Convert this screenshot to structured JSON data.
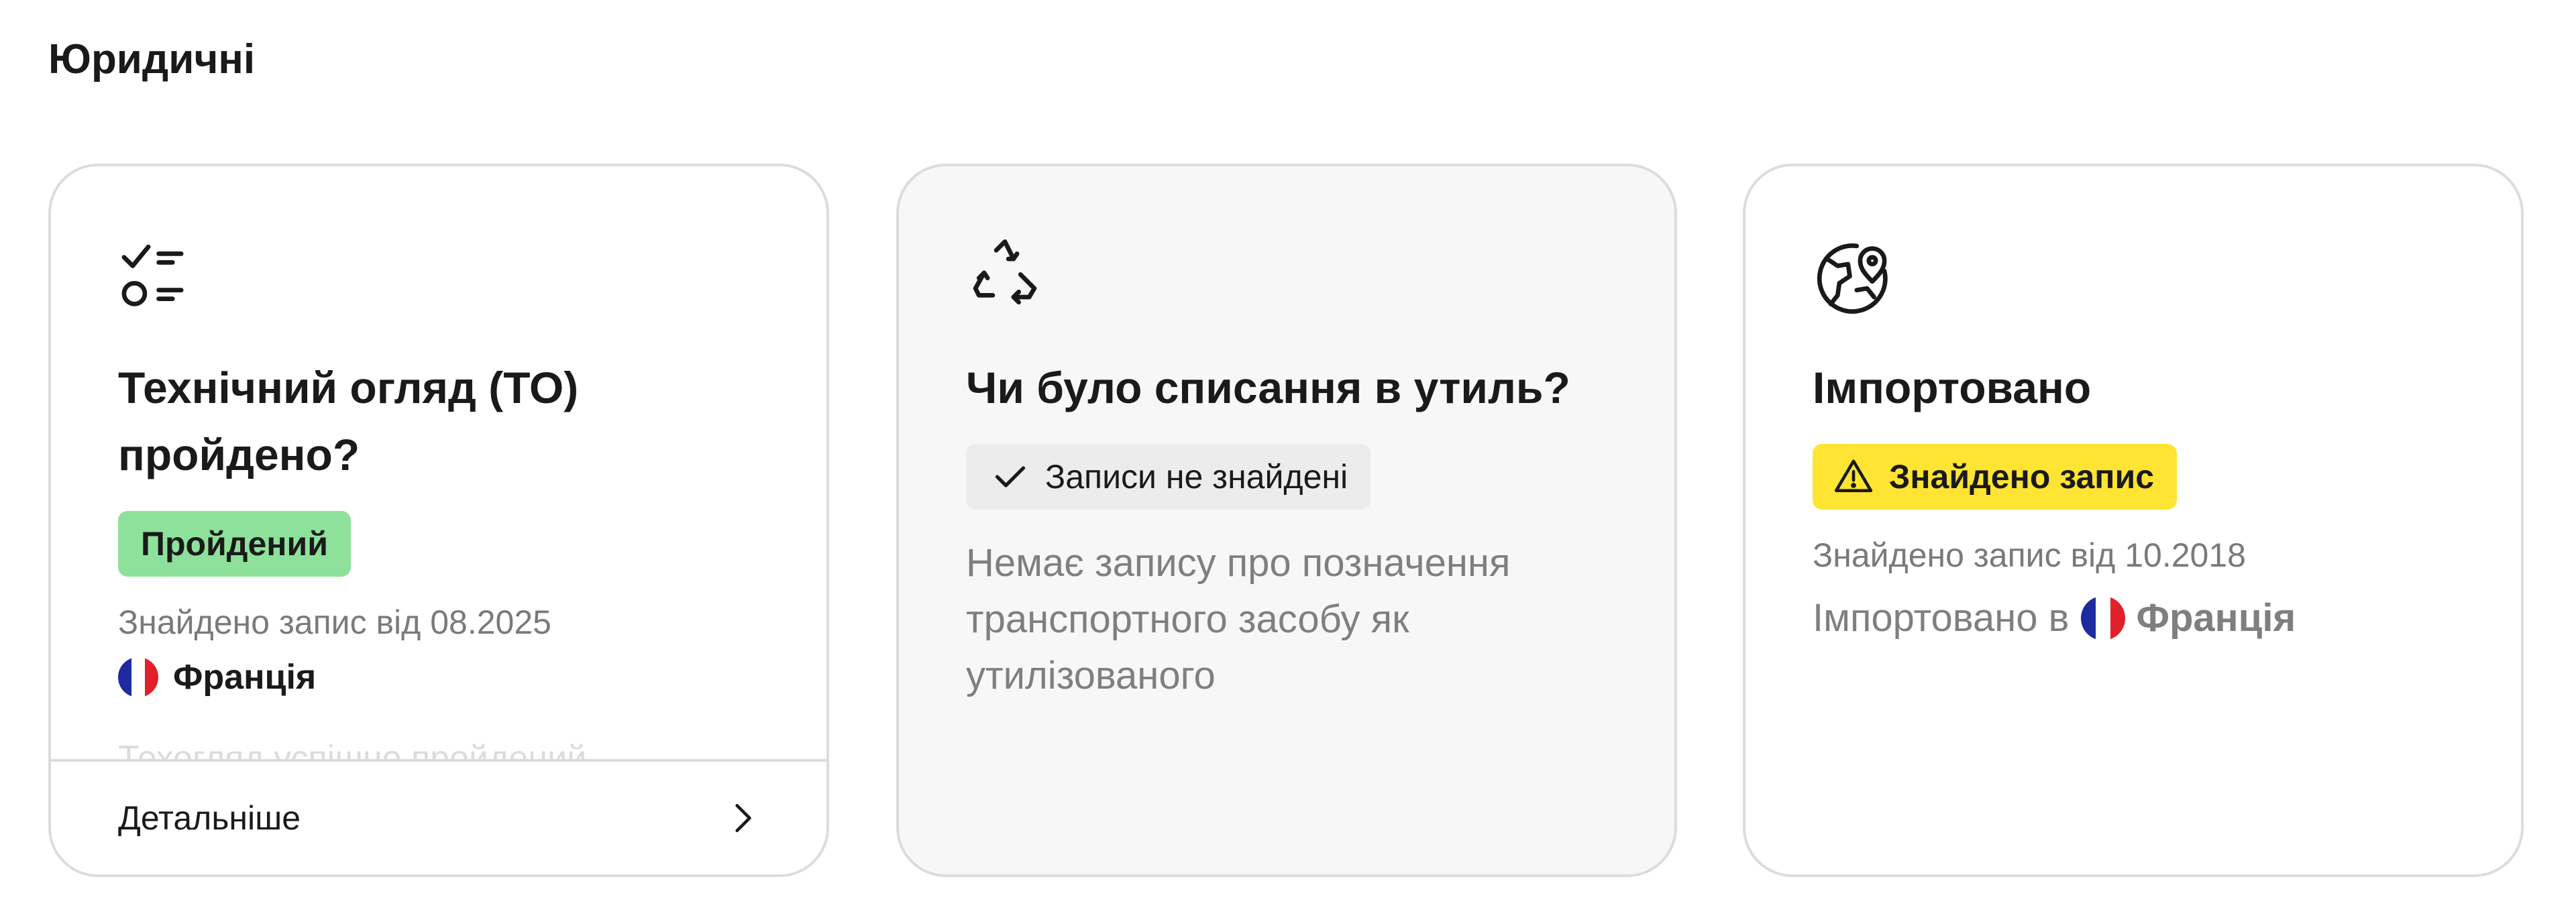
{
  "section": {
    "title": "Юридичні"
  },
  "cards": [
    {
      "icon": "checklist-icon",
      "title_line1": "Технічний огляд (ТО)",
      "title_line2": "пройдено?",
      "badge": {
        "label": "Пройдений",
        "color": "#8ee19a"
      },
      "found": "Знайдено запис від 08.2025",
      "country": {
        "name": "Франція",
        "flag": "france-flag-icon"
      },
      "faded_text": "Техогляд успішно пройдений",
      "footer": {
        "label": "Детальніше",
        "icon": "chevron-right-icon"
      }
    },
    {
      "icon": "recycle-icon",
      "title": "Чи було списання в утиль?",
      "badge": {
        "label": "Записи не знайдені",
        "icon": "check-icon",
        "color": "#ececec"
      },
      "description": "Немає запису про позначення транспортного засобу як утилізованого"
    },
    {
      "icon": "globe-pin-icon",
      "title": "Імпортовано",
      "badge": {
        "label": "Знайдено запис",
        "icon": "warning-icon",
        "color": "#ffe433"
      },
      "found": "Знайдено запис від 10.2018",
      "import_prefix": "Імпортовано в",
      "country": {
        "name": "Франція",
        "flag": "france-flag-icon"
      }
    }
  ]
}
